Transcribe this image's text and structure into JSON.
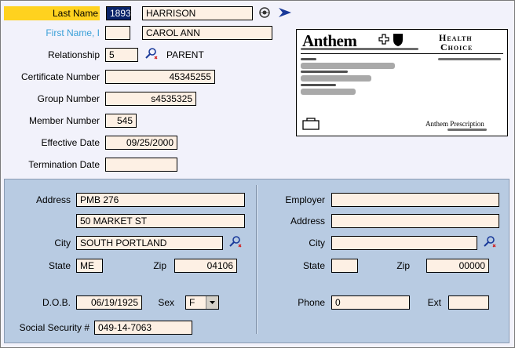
{
  "member": {
    "last_name_label": "Last Name",
    "last_name_code": "1893",
    "last_name": "HARRISON",
    "first_name_label": "First Name, I",
    "first_name_initial": "",
    "first_name": "CAROL ANN",
    "relationship_label": "Relationship",
    "relationship_code": "5",
    "relationship_text": "PARENT",
    "certificate_label": "Certificate Number",
    "certificate_value": "45345255",
    "group_label": "Group Number",
    "group_value": "s4535325",
    "member_number_label": "Member Number",
    "member_number_value": "545",
    "effective_label": "Effective Date",
    "effective_value": "09/25/2000",
    "termination_label": "Termination Date",
    "termination_value": ""
  },
  "card": {
    "brand": "Anthem",
    "plan_line1": "Health",
    "plan_line2": "Choice",
    "footer": "Anthem Prescription"
  },
  "address": {
    "address_label": "Address",
    "address1": "PMB 276",
    "address2": "50 MARKET ST",
    "city_label": "City",
    "city": "SOUTH PORTLAND",
    "state_label": "State",
    "state": "ME",
    "zip_label": "Zip",
    "zip": "04106",
    "dob_label": "D.O.B.",
    "dob": "06/19/1925",
    "sex_label": "Sex",
    "sex": "F",
    "ssn_label": "Social Security #",
    "ssn": "049-14-7063"
  },
  "employer": {
    "employer_label": "Employer",
    "employer": "",
    "address_label": "Address",
    "address": "",
    "city_label": "City",
    "city": "",
    "state_label": "State",
    "state": "",
    "zip_label": "Zip",
    "zip": "00000",
    "phone_label": "Phone",
    "phone": "0",
    "ext_label": "Ext",
    "ext": ""
  },
  "colors": {
    "highlight": "#ffd21f",
    "first_name_label": "#3aa0d8",
    "field_bg": "#fdf0e4",
    "panel_bg": "#b8cbe2",
    "selected_code_bg": "#0a246a"
  }
}
